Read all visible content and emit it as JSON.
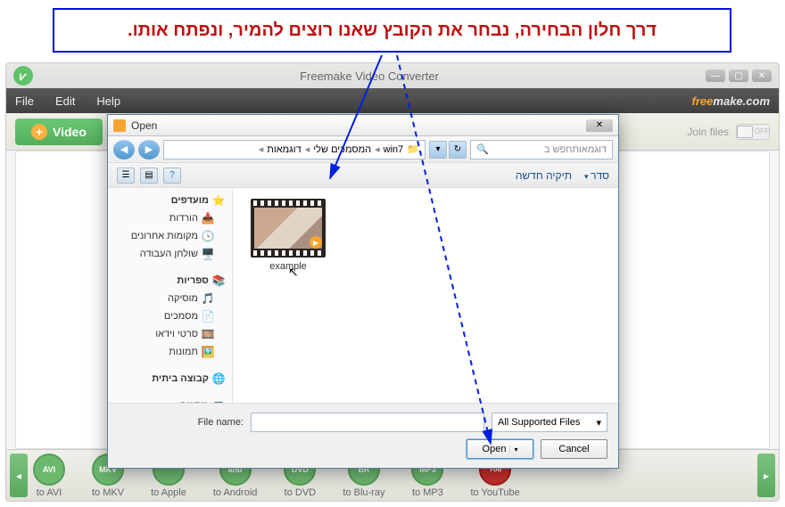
{
  "callout": "דרך חלון הבחירה, נבחר את הקובץ שאנו רוצים להמיר, ונפתח אותו.",
  "app": {
    "title": "Freemake Video Converter",
    "brand_f": "free",
    "brand_r": "make.com",
    "menu": {
      "file": "File",
      "edit": "Edit",
      "help": "Help"
    },
    "video_btn": "Video",
    "join_files": "Join files",
    "toggle_off": "OFF"
  },
  "formats": [
    {
      "label": "to AVI",
      "icon": "AVI"
    },
    {
      "label": "to MKV",
      "icon": "MKV"
    },
    {
      "label": "to Apple",
      "icon": ""
    },
    {
      "label": "to Android",
      "icon": "and"
    },
    {
      "label": "to DVD",
      "icon": "DVD"
    },
    {
      "label": "to Blu-ray",
      "icon": "BR"
    },
    {
      "label": "to MP3",
      "icon": "MP3"
    },
    {
      "label": "to YouTube",
      "icon": "You"
    }
  ],
  "dialog": {
    "title": "Open",
    "breadcrumb": [
      "win7",
      "המסמכים שלי",
      "דוגמאות"
    ],
    "search_placeholder": "דוגמאותחפש ב",
    "toolbar": {
      "sort": "סדר",
      "new_folder": "תיקיה חדשה"
    },
    "sidebar": {
      "favorites": "מועדפים",
      "downloads": "הורדות",
      "recent": "מקומות אחרונים",
      "desktop": "שולחן העבודה",
      "libraries": "ספריות",
      "music": "מוסיקה",
      "documents": "מסמכים",
      "videos": "סרטי וידאו",
      "pictures": "תמונות",
      "homegroup": "קבוצה ביתית",
      "computer": "מחשב"
    },
    "file": {
      "name": "example"
    },
    "footer": {
      "filename_label": "File name:",
      "filter": "All Supported Files",
      "open": "Open",
      "cancel": "Cancel"
    }
  }
}
